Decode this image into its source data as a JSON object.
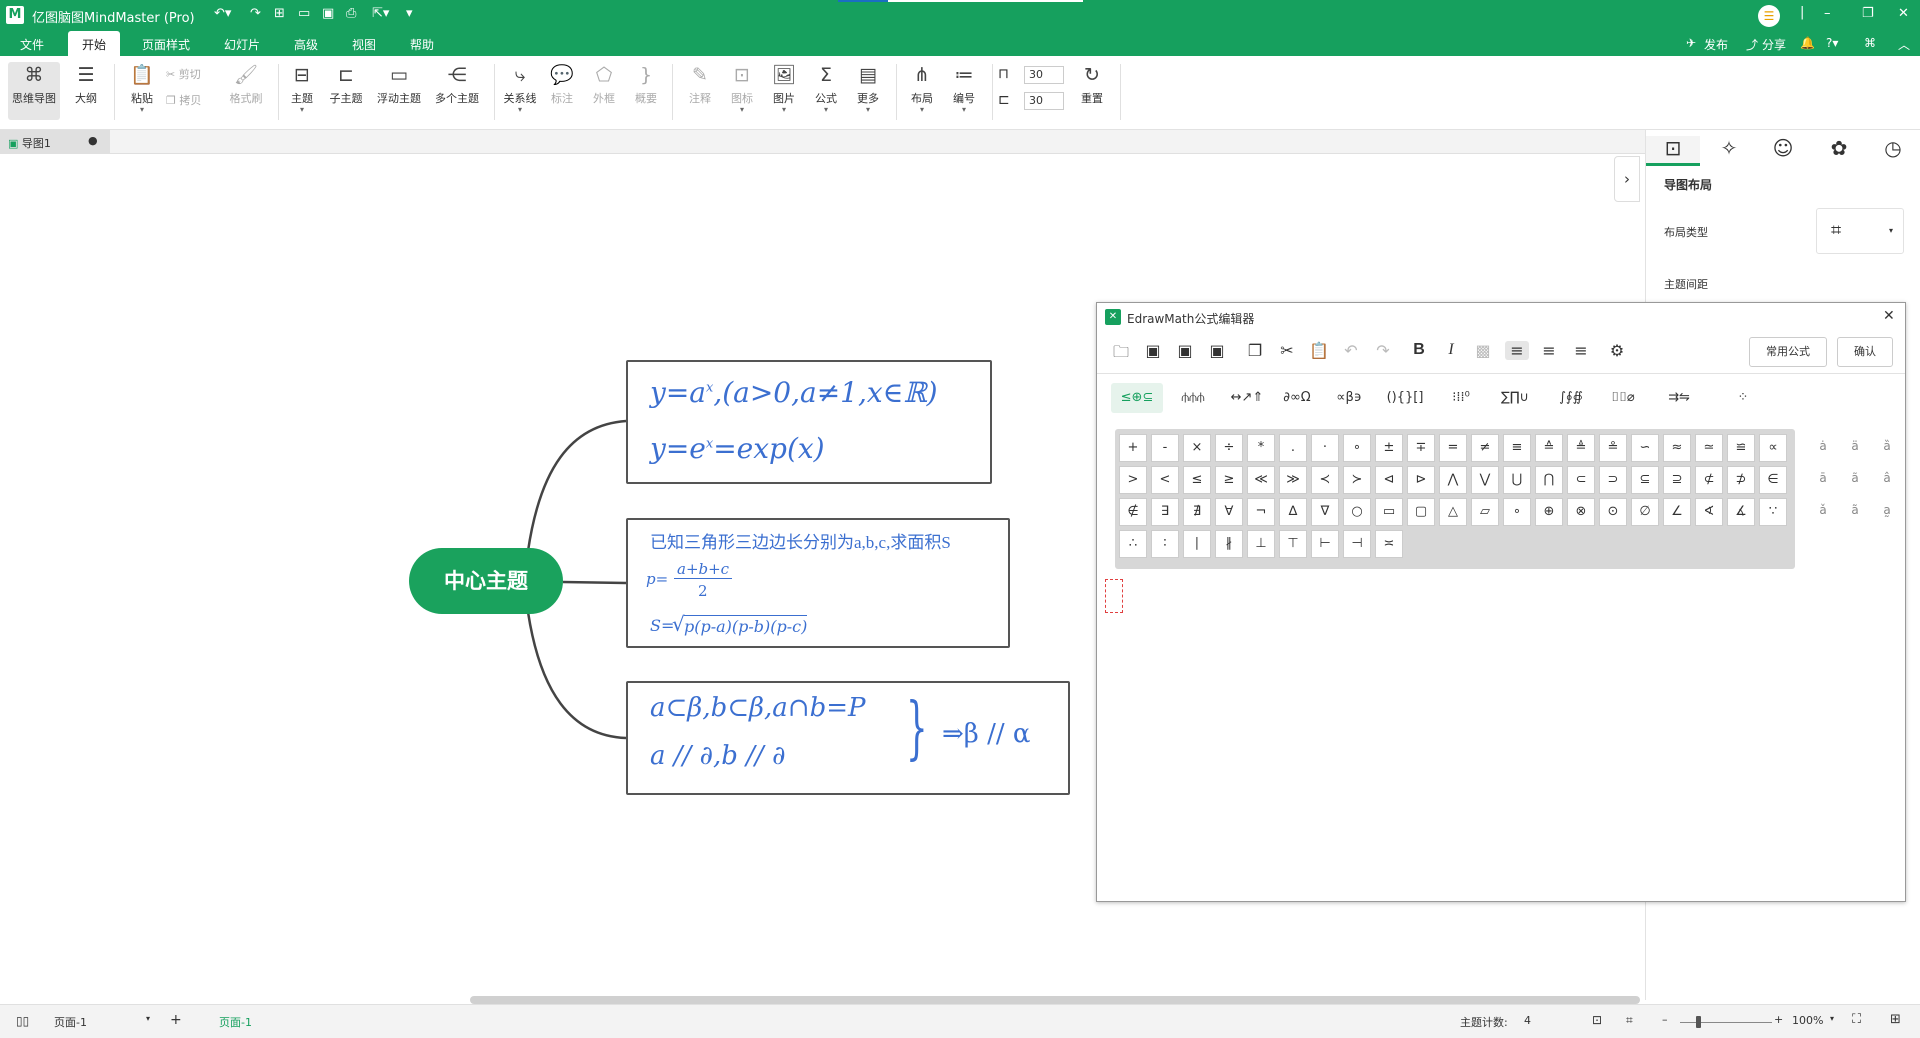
{
  "app": {
    "title": "亿图脑图MindMaster (Pro)",
    "logo": "M"
  },
  "menu": {
    "items": [
      "文件",
      "开始",
      "页面样式",
      "幻灯片",
      "高级",
      "视图",
      "帮助"
    ],
    "active": "开始",
    "right": {
      "publish": "发布",
      "share": "分享"
    }
  },
  "ribbon": {
    "mindmap": "思维导图",
    "outline": "大纲",
    "paste": "粘贴",
    "cut": "剪切",
    "copy": "拷贝",
    "format_painter": "格式刷",
    "topic": "主题",
    "subtopic": "子主题",
    "floating_topic": "浮动主题",
    "multi_topic": "多个主题",
    "relation": "关系线",
    "callout": "标注",
    "boundary": "外框",
    "summary": "概要",
    "note": "注释",
    "icon": "图标",
    "picture": "图片",
    "formula": "公式",
    "more": "更多",
    "layout": "布局",
    "numbering": "编号",
    "spacing_h": "30",
    "spacing_v": "30",
    "reset": "重置"
  },
  "doc_tab": {
    "name": "导图1"
  },
  "mindmap": {
    "central": "中心主题",
    "topic1": {
      "line1": "y=a",
      "line1_sup": "x",
      "line1_rest": ",(a>0,a≠1,x∈ℝ)",
      "line2": "y=e",
      "line2_sup": "x",
      "line2_rest": "=exp(x)"
    },
    "topic2": {
      "line1": "已知三角形三边边长分别为a,b,c,求面积S",
      "p_lhs": "p=",
      "p_num": "a+b+c",
      "p_den": "2",
      "s_lhs": "S=",
      "s_rad": "p(p-a)(p-b)(p-c)"
    },
    "topic3": {
      "line1": "a⊂β,b⊂β,a∩b=P",
      "line2": "a // ∂,b // ∂",
      "brace": "}",
      "result": "⇒β // α"
    }
  },
  "right_panel": {
    "section": "导图布局",
    "layout_type_label": "布局类型",
    "topic_spacing_label": "主题间距"
  },
  "dialog": {
    "title": "EdrawMath公式编辑器",
    "common_formula": "常用公式",
    "confirm": "确认",
    "symbol_tabs": [
      "≤⊕⊆",
      "⫛⫛⫛",
      "↔↗⇑",
      "∂∞Ω",
      "∝β϶",
      "(){}[]",
      "⁝⁞⁞⁰",
      "∑∏∪",
      "∫∮∯",
      "⌷⌷⌀",
      "⇉⇋",
      "⁘"
    ],
    "symbols_row1": [
      "+",
      "-",
      "×",
      "÷",
      "*",
      ".",
      "·",
      "∘",
      "±",
      "∓",
      "=",
      "≠",
      "≡",
      "≙",
      "≜",
      "≗",
      "∽",
      "≈",
      "≃",
      "≌",
      "∝"
    ],
    "symbols_row2": [
      ">",
      "<",
      "≤",
      "≥",
      "≪",
      "≫",
      "≺",
      "≻",
      "⊲",
      "⊳",
      "⋀",
      "⋁",
      "⋃",
      "⋂",
      "⊂",
      "⊃",
      "⊆",
      "⊇",
      "⊄",
      "⊅",
      "∈"
    ],
    "symbols_row3": [
      "∉",
      "∃",
      "∄",
      "∀",
      "¬",
      "∆",
      "∇",
      "○",
      "▭",
      "▢",
      "△",
      "▱",
      "∘",
      "⊕",
      "⊗",
      "⊙",
      "∅",
      "∠",
      "∢",
      "∡",
      "∵"
    ],
    "symbols_row4": [
      "∴",
      "∶",
      "∣",
      "∦",
      "⊥",
      "⊤",
      "⊢",
      "⊣",
      "≍"
    ],
    "accents": [
      "ȧ",
      "ä",
      "ȁ",
      "ā",
      "ã",
      "â",
      "ǎ",
      "a͂",
      "a̰"
    ]
  },
  "status": {
    "page_select": "页面-1",
    "page_tab": "页面-1",
    "topic_count_label": "主题计数:",
    "topic_count": "4",
    "zoom": "100%"
  },
  "colors": {
    "brand_green": "#16a05e",
    "math_blue": "#3b6fd0"
  }
}
